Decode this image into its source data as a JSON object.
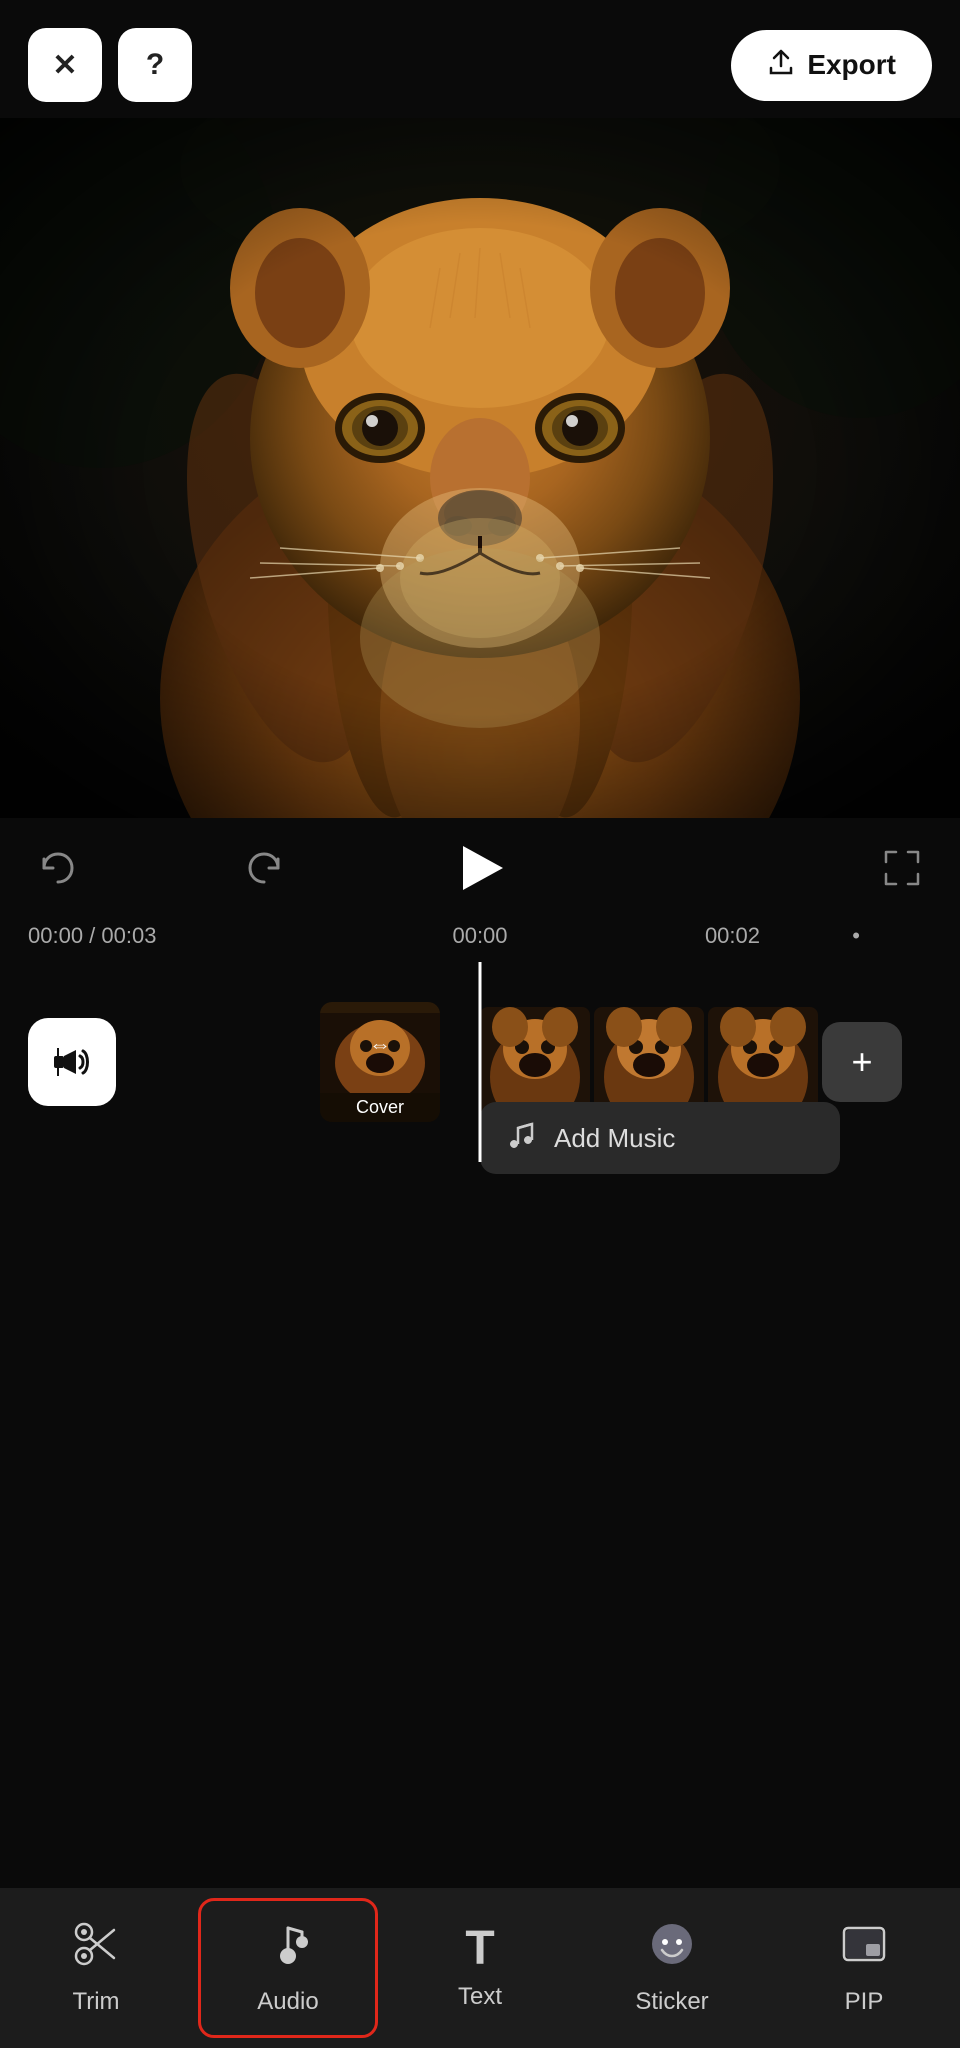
{
  "header": {
    "close_label": "✕",
    "help_label": "?",
    "export_label": "Export",
    "export_icon": "↑"
  },
  "playback": {
    "current_time": "00:00",
    "total_time": "00:03",
    "time_display": "00:00 / 00:03",
    "marker_time1": "00:00",
    "marker_time2": "00:02",
    "undo_icon": "↩",
    "redo_icon": "↪"
  },
  "timeline": {
    "cover_label": "Cover",
    "add_music_label": "Add Music"
  },
  "toolbar": {
    "items": [
      {
        "id": "trim",
        "label": "Trim",
        "icon": "✂"
      },
      {
        "id": "audio",
        "label": "Audio",
        "icon": "♪",
        "active": true
      },
      {
        "id": "text",
        "label": "Text",
        "icon": "T"
      },
      {
        "id": "sticker",
        "label": "Sticker",
        "icon": "⬤"
      },
      {
        "id": "pip",
        "label": "PIP",
        "icon": "⊞"
      }
    ]
  }
}
